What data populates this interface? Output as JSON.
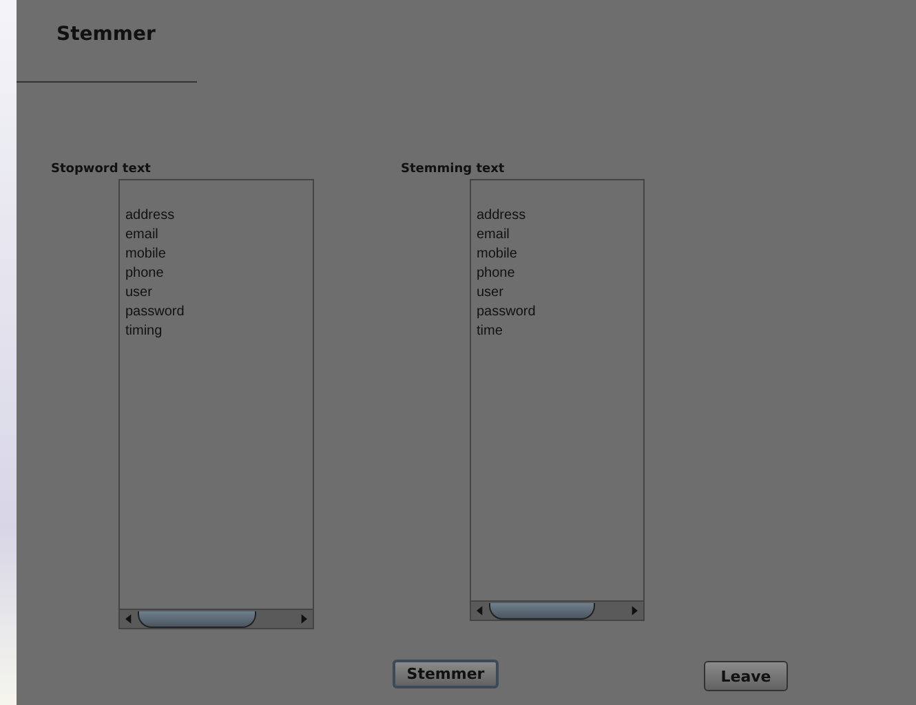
{
  "title": "Stemmer",
  "panels": [
    {
      "label": "Stopword text",
      "lines": [
        "address",
        "email",
        "mobile",
        "phone",
        "user",
        "password",
        "timing"
      ]
    },
    {
      "label": "Stemming text",
      "lines": [
        "address",
        "email",
        "mobile",
        "phone",
        "user",
        "password",
        "time"
      ]
    }
  ],
  "buttons": [
    {
      "label": "Stemmer",
      "focused": true
    },
    {
      "label": "Leave",
      "focused": false
    }
  ]
}
